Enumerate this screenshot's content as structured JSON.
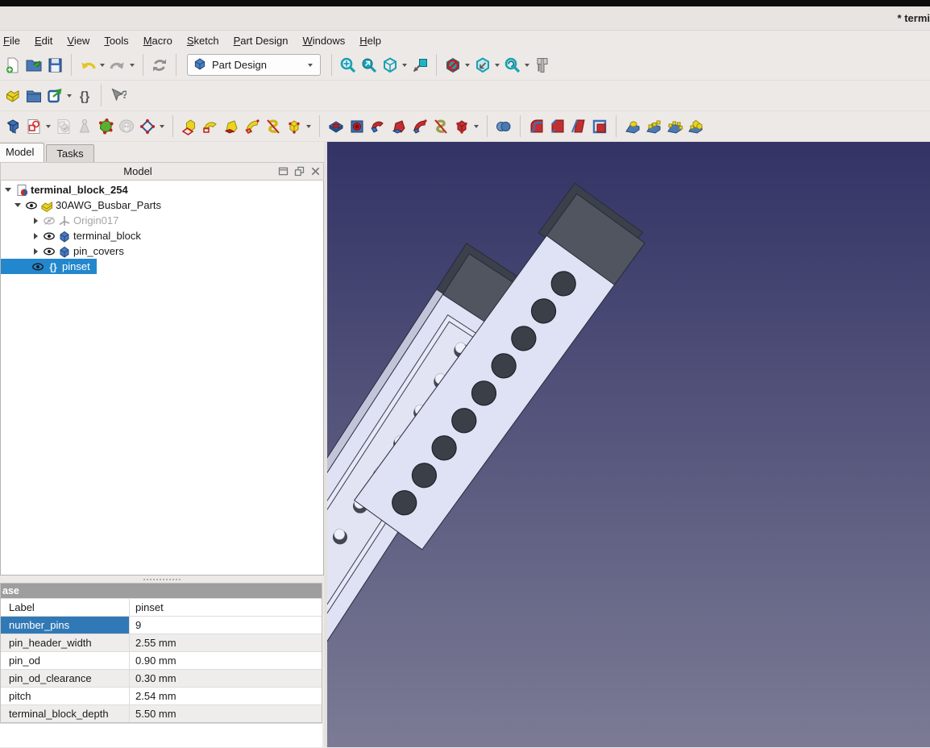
{
  "window": {
    "title_visible": "* termi"
  },
  "menu": {
    "items": [
      "File",
      "Edit",
      "View",
      "Tools",
      "Macro",
      "Sketch",
      "Part Design",
      "Windows",
      "Help"
    ]
  },
  "toolbars": {
    "workbench_selector": "Part Design",
    "file_group": [
      "new-file",
      "open-folder",
      "save"
    ],
    "undo_group": [
      "undo*",
      "redo*"
    ],
    "refresh_group": [
      "refresh"
    ],
    "view_group": [
      "fit-all",
      "fit-selection",
      "isometric*",
      "box-selection"
    ],
    "view_group2": [
      "clipping*",
      "axonometric*",
      "zoom-refresh*",
      "measure"
    ],
    "structure_group": [
      "part-workbench",
      "folder-group",
      "export-link*",
      "varset"
    ],
    "help_group": [
      "whats-this"
    ],
    "pd_sketch_group": [
      "create-body",
      "create-sketch*",
      "g:edit-sketch",
      "g:map-sketch",
      "validate-sketch",
      "g:shape-binder",
      "datum*"
    ],
    "pd_additive_group": [
      "pad",
      "revolution",
      "loft",
      "sweep",
      "helix",
      "primitive*"
    ],
    "pd_subtractive_group": [
      "pocket",
      "hole",
      "groove",
      "sub-loft",
      "sub-sweep",
      "sub-helix",
      "sub-primitive*"
    ],
    "pd_boolean_group": [
      "boolean"
    ],
    "pd_dressup_group": [
      "fillet",
      "chamfer",
      "draft",
      "thickness"
    ],
    "pd_transform_group": [
      "mirror",
      "linear-pattern",
      "polar-pattern",
      "multitransform"
    ]
  },
  "dock": {
    "tabs": [
      {
        "label": "Model",
        "active": true
      },
      {
        "label": "Tasks",
        "active": false
      }
    ],
    "panel_title": "Model",
    "tree": [
      {
        "label": "terminal_block_254",
        "icon": "document",
        "bold": true,
        "depth": 0,
        "expander": "open",
        "eye": "none"
      },
      {
        "label": "30AWG_Busbar_Parts",
        "icon": "part-yellow",
        "depth": 1,
        "expander": "open",
        "eye": "visible"
      },
      {
        "label": "Origin017",
        "icon": "origin",
        "depth": 2,
        "expander": "closed",
        "eye": "hidden",
        "muted": true
      },
      {
        "label": "terminal_block",
        "icon": "part-blue",
        "depth": 2,
        "expander": "closed",
        "eye": "visible"
      },
      {
        "label": "pin_covers",
        "icon": "part-blue",
        "depth": 2,
        "expander": "closed",
        "eye": "visible"
      },
      {
        "label": "pinset",
        "icon": "varset",
        "depth": 2,
        "expander": "none",
        "eye": "visible",
        "selected": true
      }
    ],
    "properties": {
      "group_label": "ase",
      "rows": [
        {
          "name": "Label",
          "value": "pinset"
        },
        {
          "name": "number_pins",
          "value": "9",
          "selected": true
        },
        {
          "name": "pin_header_width",
          "value": "2.55 mm"
        },
        {
          "name": "pin_od",
          "value": "0.90 mm"
        },
        {
          "name": "pin_od_clearance",
          "value": "0.30 mm"
        },
        {
          "name": "pitch",
          "value": "2.54 mm"
        },
        {
          "name": "terminal_block_depth",
          "value": "5.50 mm"
        }
      ]
    }
  },
  "viewport": {
    "bg_top": "#333366",
    "bg_bottom": "#7b7b95",
    "body_color": "#dfe2f4",
    "body_side_color": "#c2c5da",
    "cap_color": "#51555f",
    "cap_dark_color": "#3c404a",
    "hole_color": "#3b3f48",
    "outline_color": "#2b2b3c",
    "pin_count": 9,
    "hole_count": 9
  }
}
